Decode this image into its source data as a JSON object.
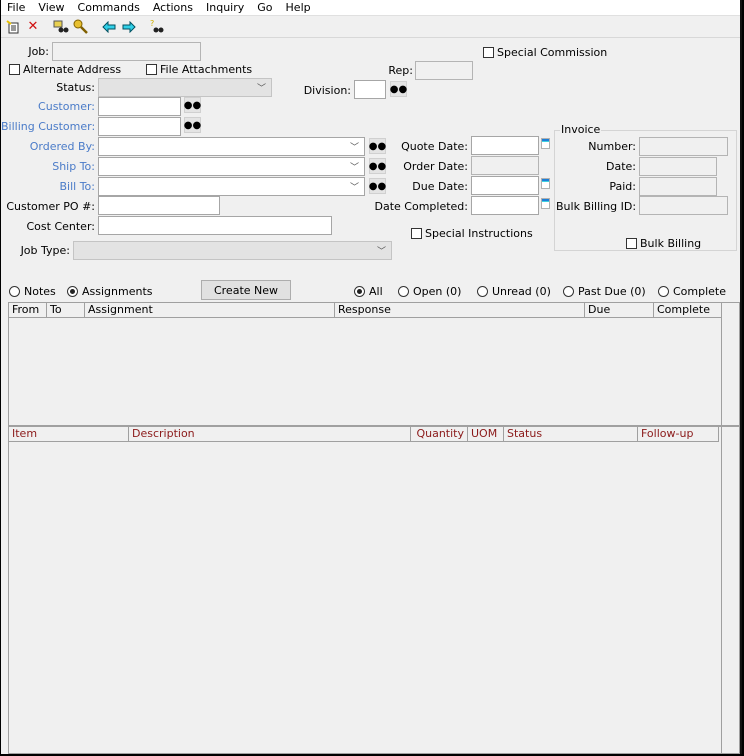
{
  "menu": [
    "File",
    "View",
    "Commands",
    "Actions",
    "Inquiry",
    "Go",
    "Help"
  ],
  "toolbar": {
    "icons": [
      "new-document-icon",
      "delete-icon",
      "search-job-icon",
      "key-icon",
      "back-arrow-icon",
      "forward-arrow-icon",
      "help-search-icon"
    ]
  },
  "form": {
    "job_label": "Job:",
    "job_value": "",
    "alternate_address": "Alternate Address",
    "file_attachments": "File Attachments",
    "special_commission": "Special Commission",
    "rep_label": "Rep:",
    "rep_value": "",
    "status_label": "Status:",
    "status_value": "",
    "division_label": "Division:",
    "division_value": "",
    "customer_label": "Customer:",
    "customer_value": "",
    "billing_customer_label": "Billing Customer:",
    "billing_customer_value": "",
    "ordered_by_label": "Ordered By:",
    "ordered_by_value": "",
    "ship_to_label": "Ship To:",
    "ship_to_value": "",
    "bill_to_label": "Bill To:",
    "bill_to_value": "",
    "customer_po_label": "Customer PO #:",
    "customer_po_value": "",
    "cost_center_label": "Cost Center:",
    "cost_center_value": "",
    "job_type_label": "Job Type:",
    "job_type_value": "",
    "quote_date_label": "Quote Date:",
    "quote_date_value": "",
    "order_date_label": "Order Date:",
    "order_date_value": "",
    "due_date_label": "Due Date:",
    "due_date_value": "",
    "date_completed_label": "Date Completed:",
    "date_completed_value": "",
    "special_instructions": "Special Instructions"
  },
  "invoice": {
    "title": "Invoice",
    "number_label": "Number:",
    "number_value": "",
    "date_label": "Date:",
    "date_value": "",
    "paid_label": "Paid:",
    "paid_value": "",
    "bulk_billing_id_label": "Bulk Billing ID:",
    "bulk_billing_id_value": "",
    "bulk_billing": "Bulk Billing"
  },
  "assignments": {
    "mode_notes": "Notes",
    "mode_assignments": "Assignments",
    "selected_mode": "Assignments",
    "create_new": "Create New",
    "filters": [
      "All",
      "Open (0)",
      "Unread (0)",
      "Past Due (0)",
      "Complete"
    ],
    "selected_filter": "All",
    "columns": [
      "From",
      "To",
      "Assignment",
      "Response",
      "Due",
      "Complete"
    ],
    "rows": []
  },
  "items": {
    "columns": [
      "Item",
      "Description",
      "Quantity",
      "UOM",
      "Status",
      "Follow-up"
    ],
    "rows": []
  },
  "colors": {
    "link_label": "#4a7bc8",
    "item_header": "#8b1a1a",
    "window_bg": "#f0f0f0"
  }
}
